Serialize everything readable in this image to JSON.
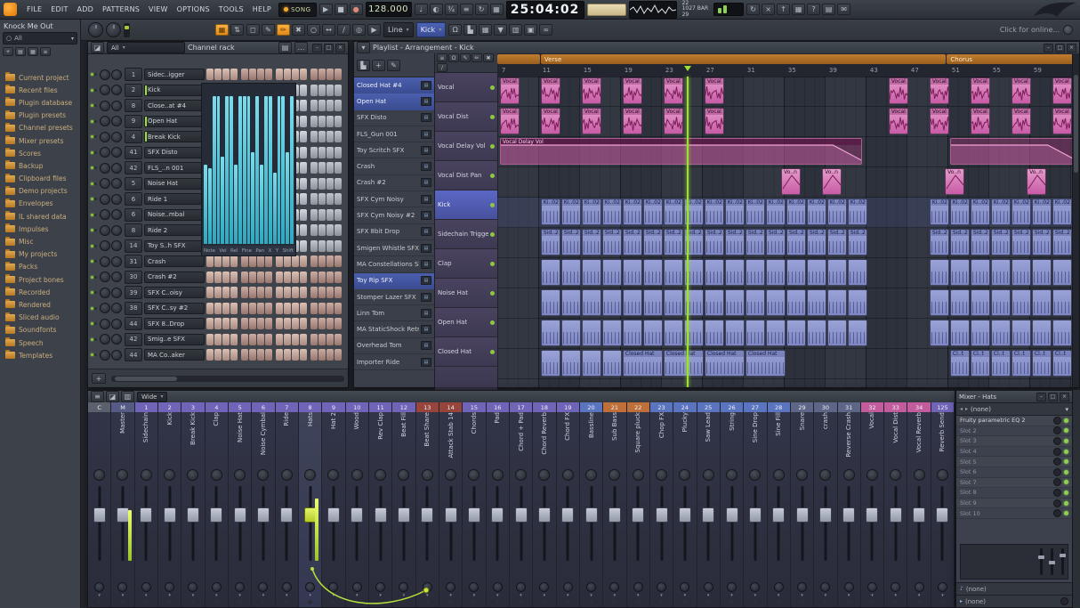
{
  "colors": {
    "accent": "#f7a92e",
    "playhead": "#9be22e",
    "audio_clip": "#d874b8",
    "pattern_clip": "#8e96ce",
    "automation_clip": "#a03c7c",
    "meter_green": "#cde23c",
    "lcd": "#d9e8c4"
  },
  "app": {
    "menu": [
      "FILE",
      "EDIT",
      "ADD",
      "PATTERNS",
      "VIEW",
      "OPTIONS",
      "TOOLS",
      "HELP"
    ],
    "mode": "SONG",
    "tempo": "128.000",
    "time": "25:04:02",
    "counter_top": "22",
    "counter_bar": "1027 BAR",
    "counter_beat": "29",
    "online_hint": "Click for online...",
    "shape_tool": "Line",
    "target_selector": "Kick",
    "window_buttons": [
      {
        "n": "minimize-button",
        "g": "–"
      },
      {
        "n": "maximize-button",
        "g": "□"
      },
      {
        "n": "close-button",
        "g": "×"
      }
    ],
    "transport": [
      {
        "n": "play-button",
        "g": "▶"
      },
      {
        "n": "stop-button",
        "g": "■"
      },
      {
        "n": "record-button",
        "g": "●"
      }
    ],
    "icons_mid": [
      {
        "n": "metronome-icon",
        "g": "♩"
      },
      {
        "n": "wait-for-input-icon",
        "g": "◐"
      },
      {
        "n": "countdown-icon",
        "g": "¾"
      },
      {
        "n": "blend-recording-icon",
        "g": "≡"
      },
      {
        "n": "loop-record-icon",
        "g": "↻"
      },
      {
        "n": "step-edit-icon",
        "g": "▦"
      }
    ],
    "icons_right": [
      {
        "n": "sync-update-icon",
        "g": "↻"
      },
      {
        "n": "abort-icon",
        "g": "×"
      },
      {
        "n": "render-icon",
        "g": "↑"
      },
      {
        "n": "typing-keyboard-icon",
        "g": "▦"
      },
      {
        "n": "help-icon",
        "g": "?"
      },
      {
        "n": "plugin-picker-icon",
        "g": "▤"
      },
      {
        "n": "chat-icon",
        "g": "✉"
      }
    ],
    "row2_groupA": [
      {
        "n": "pattern-picker-icon",
        "g": "▦",
        "accent": true
      },
      {
        "n": "pattern-spinner-icon",
        "g": "⇅"
      }
    ],
    "row2_tools": [
      {
        "n": "select-tool-icon",
        "g": "◻"
      },
      {
        "n": "pencil-tool-icon",
        "g": "✎"
      },
      {
        "n": "brush-tool-icon",
        "g": "✏",
        "active": true
      },
      {
        "n": "delete-tool-icon",
        "g": "✖"
      },
      {
        "n": "mute-tool-icon",
        "g": "○"
      },
      {
        "n": "slip-tool-icon",
        "g": "↔"
      },
      {
        "n": "slice-tool-icon",
        "g": "∕"
      },
      {
        "n": "zoom-tool-icon",
        "g": "◎"
      },
      {
        "n": "playback-tool-icon",
        "g": "▶"
      }
    ],
    "row2_groupB": [
      {
        "n": "snap-magnet-icon",
        "g": "Ω"
      },
      {
        "n": "picker-panel-icon",
        "g": "▙"
      },
      {
        "n": "grid-color-icon",
        "g": "▦"
      },
      {
        "n": "marker-dropdown-icon",
        "g": "▼"
      },
      {
        "n": "maximize-tracks-icon",
        "g": "▥"
      },
      {
        "n": "performance-mode-icon",
        "g": "▣"
      },
      {
        "n": "multilink-icon",
        "g": "∞"
      }
    ]
  },
  "browser": {
    "title": "Knock Me Out",
    "search": "All",
    "toolbar_icons": [
      {
        "n": "browser-add-icon",
        "g": "+"
      },
      {
        "n": "browser-folder-icon",
        "g": "▤"
      },
      {
        "n": "browser-view-icon",
        "g": "▦"
      },
      {
        "n": "browser-menu-icon",
        "g": "≡"
      }
    ],
    "items": [
      "Current project",
      "Recent files",
      "Plugin database",
      "Plugin presets",
      "Channel presets",
      "Mixer presets",
      "Scores",
      "Backup",
      "Clipboard files",
      "Demo projects",
      "Envelopes",
      "IL shared data",
      "Impulses",
      "Misc",
      "My projects",
      "Packs",
      "Project bones",
      "Recorded",
      "Rendered",
      "Sliced audio",
      "Soundfonts",
      "Speech",
      "Templates"
    ]
  },
  "channel_rack": {
    "title": "Channel rack",
    "filter": "All",
    "add_label": "+",
    "channels": [
      {
        "n": "1",
        "name": "Sidec..igger",
        "tint": "r"
      },
      {
        "n": "2",
        "name": "Kick",
        "tint": "s",
        "sel": true
      },
      {
        "n": "8",
        "name": "Close..at #4",
        "tint": "s"
      },
      {
        "n": "9",
        "name": "Open Hat",
        "tint": "s",
        "sel": true
      },
      {
        "n": "4",
        "name": "Break Kick",
        "tint": "s",
        "sel": true
      },
      {
        "n": "41",
        "name": "SFX Disto",
        "tint": "s"
      },
      {
        "n": "42",
        "name": "FLS_..n 001",
        "tint": "s"
      },
      {
        "n": "5",
        "name": "Noise Hat",
        "tint": "s"
      },
      {
        "n": "6",
        "name": "Ride 1",
        "tint": "s"
      },
      {
        "n": "6",
        "name": "Noise..mbal",
        "tint": "s"
      },
      {
        "n": "8",
        "name": "Ride 2",
        "tint": "s"
      },
      {
        "n": "14",
        "name": "Toy S..h SFX",
        "tint": "s"
      },
      {
        "n": "31",
        "name": "Crash",
        "tint": "r"
      },
      {
        "n": "30",
        "name": "Crash #2",
        "tint": "r"
      },
      {
        "n": "39",
        "name": "SFX C..oisy",
        "tint": "r"
      },
      {
        "n": "38",
        "name": "SFX C..sy #2",
        "tint": "r"
      },
      {
        "n": "44",
        "name": "SFX 8..Drop",
        "tint": "r"
      },
      {
        "n": "42",
        "name": "Smig..e SFX",
        "tint": "r"
      },
      {
        "n": "44",
        "name": "MA Co..aker",
        "tint": "r"
      }
    ],
    "graph": {
      "targets": [
        "Note",
        "Vel",
        "Rel",
        "Fine",
        "Pan",
        "X",
        "Y",
        "Shift"
      ],
      "values": [
        0.5,
        0.48,
        0.93,
        0.93,
        0.55,
        0.93,
        0.93,
        0.5,
        0.93,
        0.93,
        0.93,
        0.58,
        0.93,
        0.5,
        0.93,
        0.93,
        0.45,
        0.93,
        0.93,
        0.58,
        0.93
      ]
    }
  },
  "picker": {
    "items": [
      {
        "label": "Closed Hat #4",
        "sel": true
      },
      {
        "label": "Open Hat",
        "sel": true
      },
      {
        "label": "SFX Disto"
      },
      {
        "label": "FLS_Gun 001"
      },
      {
        "label": "Toy Scritch SFX"
      },
      {
        "label": "Crash"
      },
      {
        "label": "Crash #2"
      },
      {
        "label": "SFX Cym Noisy"
      },
      {
        "label": "SFX Cym Noisy #2"
      },
      {
        "label": "SFX 8bit Drop"
      },
      {
        "label": "Smigen Whistle SFX"
      },
      {
        "label": "MA Constellations Sh.."
      },
      {
        "label": "Toy Rip SFX",
        "sel": true
      },
      {
        "label": "Stomper Lazer SFX"
      },
      {
        "label": "Linn Tom"
      },
      {
        "label": "MA StaticShock Retro.."
      },
      {
        "label": "Overhead Tom"
      },
      {
        "label": "Importer Ride"
      }
    ],
    "toolbar_icons": [
      {
        "n": "picker-view-icon",
        "g": "▙"
      },
      {
        "n": "picker-add-icon",
        "g": "+"
      },
      {
        "n": "picker-edit-icon",
        "g": "✎"
      }
    ]
  },
  "playlist": {
    "title": "Playlist - Arrangement - Kick",
    "toolbar_icons": [
      {
        "n": "playlist-menu-icon",
        "g": "≡"
      },
      {
        "n": "playlist-snap-icon",
        "g": "Ω"
      },
      {
        "n": "playlist-pencil-icon",
        "g": "✎"
      },
      {
        "n": "playlist-brush-icon",
        "g": "✏"
      },
      {
        "n": "playlist-delete-icon",
        "g": "✖"
      },
      {
        "n": "playlist-slice-icon",
        "g": "∕"
      }
    ],
    "ruler": {
      "start": 7,
      "step": 4,
      "count": 14
    },
    "markers": [
      {
        "label": "",
        "from": 6.75,
        "to": 11
      },
      {
        "label": "Verse",
        "from": 11,
        "to": 50.7
      },
      {
        "label": "Chorus",
        "from": 50.7,
        "to": 63.6
      }
    ],
    "playhead_bar": 25.3,
    "tracks": [
      {
        "name": "Vocal",
        "clips": [
          {
            "bars": [
              7,
              11,
              15,
              19,
              23,
              27,
              45,
              49,
              53,
              57,
              61
            ],
            "w": 2,
            "k": "a",
            "label": "Vocal"
          }
        ]
      },
      {
        "name": "Vocal Dist",
        "clips": [
          {
            "bars": [
              7,
              11,
              15,
              19,
              23,
              27,
              45,
              49,
              53,
              57,
              61
            ],
            "w": 2,
            "k": "a",
            "label": "Vocal"
          }
        ]
      },
      {
        "name": "Vocal Delay Vol",
        "clips": [
          {
            "bars": [
              7
            ],
            "w": 35.5,
            "k": "auto",
            "label": "Vocal Delay Vol"
          },
          {
            "bars": [
              51
            ],
            "w": 12.5,
            "k": "auto",
            "label": ""
          }
        ]
      },
      {
        "name": "Vocal Dist Pan",
        "clips": [
          {
            "bars": [
              34.5,
              38.5,
              50.5,
              58.5
            ],
            "w": 2,
            "k": "as",
            "label": "Vo..n"
          }
        ]
      },
      {
        "name": "Kick",
        "sel": true,
        "clips": [
          {
            "run": [
              11,
              41,
              2
            ],
            "w": 2,
            "k": "pl",
            "label": "Ki..02"
          },
          {
            "run": [
              49,
              61,
              2
            ],
            "w": 2,
            "k": "pl",
            "label": "Ki..02"
          }
        ]
      },
      {
        "name": "Sidechain Trigger",
        "clips": [
          {
            "run": [
              11,
              41,
              2
            ],
            "w": 2,
            "k": "pl",
            "label": "Sid..2"
          },
          {
            "run": [
              49,
              61,
              2
            ],
            "w": 2,
            "k": "pl",
            "label": "Sid..2"
          }
        ]
      },
      {
        "name": "Clap",
        "clips": [
          {
            "run": [
              11,
              41,
              2
            ],
            "w": 2,
            "k": "p"
          },
          {
            "run": [
              49,
              61,
              2
            ],
            "w": 2,
            "k": "p"
          }
        ]
      },
      {
        "name": "Noise Hat",
        "clips": [
          {
            "run": [
              11,
              41,
              2
            ],
            "w": 2,
            "k": "p"
          },
          {
            "run": [
              49,
              61,
              2
            ],
            "w": 2,
            "k": "p"
          }
        ]
      },
      {
        "name": "Open Hat",
        "clips": [
          {
            "run": [
              11,
              41,
              2
            ],
            "w": 2,
            "k": "p"
          },
          {
            "run": [
              49,
              61,
              2
            ],
            "w": 2,
            "k": "p"
          }
        ]
      },
      {
        "name": "Closed Hat",
        "clips": [
          {
            "run": [
              11,
              17,
              2
            ],
            "w": 2,
            "k": "p"
          },
          {
            "bars": [
              19,
              23,
              27,
              31
            ],
            "w": 4,
            "k": "pl",
            "label": "Closed Hat"
          },
          {
            "run": [
              51,
              61,
              2
            ],
            "w": 2,
            "k": "pl",
            "label": "Cl..t"
          }
        ]
      }
    ]
  },
  "mixer": {
    "layout": "Wide",
    "toolbar_icons": [
      {
        "n": "mixer-menu-icon",
        "g": "≡"
      },
      {
        "n": "mixer-detach-icon",
        "g": "◪"
      },
      {
        "n": "mixer-view-icon",
        "g": "▥"
      }
    ],
    "strips": [
      {
        "n": "C",
        "name": "",
        "c": "gray"
      },
      {
        "n": "M",
        "name": "Master",
        "c": "master",
        "meter": 0.7
      },
      {
        "n": "1",
        "name": "Sidechain",
        "c": "purple"
      },
      {
        "n": "2",
        "name": "Kick",
        "c": "purple"
      },
      {
        "n": "3",
        "name": "Break Kick",
        "c": "purple"
      },
      {
        "n": "4",
        "name": "Clap",
        "c": "purple"
      },
      {
        "n": "5",
        "name": "Noise Hat",
        "c": "purple"
      },
      {
        "n": "6",
        "name": "Noise Cymbal",
        "c": "purple"
      },
      {
        "n": "7",
        "name": "Ride",
        "c": "purple"
      },
      {
        "n": "8",
        "name": "Hats",
        "c": "purple",
        "sel": true,
        "meter": 0.85
      },
      {
        "n": "9",
        "name": "Hat 2",
        "c": "purple"
      },
      {
        "n": "10",
        "name": "Wood",
        "c": "purple"
      },
      {
        "n": "11",
        "name": "Rev Clap",
        "c": "purple"
      },
      {
        "n": "12",
        "name": "Beat Fill",
        "c": "purple"
      },
      {
        "n": "13",
        "name": "Beat Share",
        "c": "maroon"
      },
      {
        "n": "14",
        "name": "Attack Stab 14",
        "c": "maroon"
      },
      {
        "n": "15",
        "name": "Chords",
        "c": "purple"
      },
      {
        "n": "16",
        "name": "Pad",
        "c": "purple"
      },
      {
        "n": "17",
        "name": "Chord + Pad",
        "c": "purple"
      },
      {
        "n": "18",
        "name": "Chord Reverb",
        "c": "purple"
      },
      {
        "n": "19",
        "name": "Chord FX",
        "c": "purple"
      },
      {
        "n": "20",
        "name": "Bassline",
        "c": "blue"
      },
      {
        "n": "21",
        "name": "Sub Bass",
        "c": "orange"
      },
      {
        "n": "22",
        "name": "Square pluck",
        "c": "orange"
      },
      {
        "n": "23",
        "name": "Chop FX",
        "c": "blue"
      },
      {
        "n": "24",
        "name": "Plucky",
        "c": "blue"
      },
      {
        "n": "25",
        "name": "Saw Lead",
        "c": "blue"
      },
      {
        "n": "26",
        "name": "String",
        "c": "blue"
      },
      {
        "n": "27",
        "name": "Sine Drop",
        "c": "blue"
      },
      {
        "n": "28",
        "name": "Sine Fill",
        "c": "blue"
      },
      {
        "n": "29",
        "name": "Snare",
        "c": "slate"
      },
      {
        "n": "30",
        "name": "crash",
        "c": "slate"
      },
      {
        "n": "31",
        "name": "Reverse Crash",
        "c": "slate"
      },
      {
        "n": "32",
        "name": "Vocal",
        "c": "pink"
      },
      {
        "n": "33",
        "name": "Vocal Dist",
        "c": "pink"
      },
      {
        "n": "34",
        "name": "Vocal Reverb",
        "c": "pink"
      },
      {
        "n": "125",
        "name": "Reverb Send",
        "c": "purple"
      }
    ]
  },
  "fx": {
    "title": "Mixer - Hats",
    "preset": "(none)",
    "slots": [
      "Fruity parametric EQ 2",
      "Slot 2",
      "Slot 3",
      "Slot 4",
      "Slot 5",
      "Slot 6",
      "Slot 7",
      "Slot 8",
      "Slot 9",
      "Slot 10"
    ],
    "bottom": [
      "(none)",
      "(none)"
    ]
  }
}
